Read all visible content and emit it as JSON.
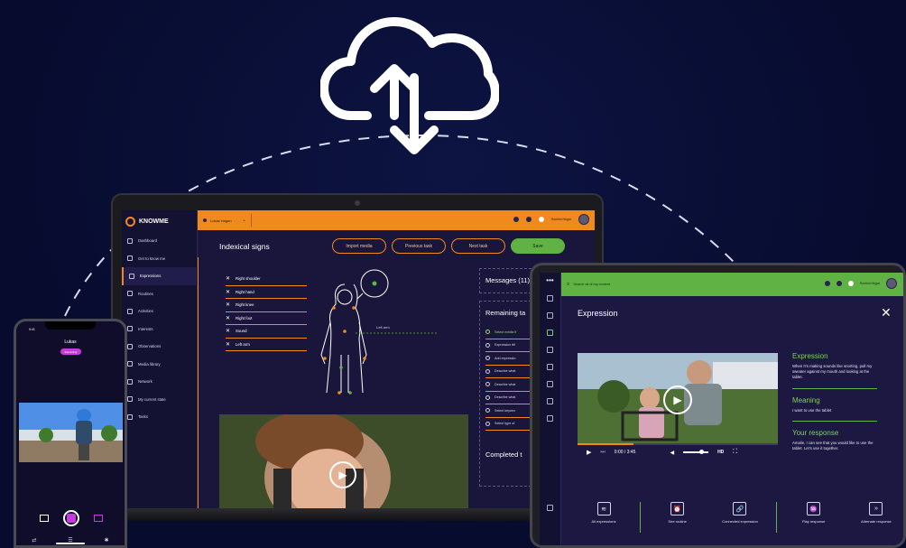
{
  "brand": {
    "name": "KNOWME",
    "accent": "#f08a1c",
    "green": "#5fb243",
    "background": "#070b2e"
  },
  "hero": {
    "icon": "cloud-upload-download-icon"
  },
  "laptop": {
    "user": "Lukas Hagen",
    "top_user": "Roshini Hegar",
    "title": "Indexical signs",
    "buttons": {
      "import": "Import media",
      "previous": "Previous task",
      "next": "Next task",
      "save": "Save"
    },
    "nav": [
      {
        "label": "Dashboard",
        "active": false
      },
      {
        "label": "Get to know me",
        "active": false
      },
      {
        "label": "Expressions",
        "active": true
      },
      {
        "label": "Routines",
        "active": false
      },
      {
        "label": "Activities",
        "active": false
      },
      {
        "label": "Interests",
        "active": false
      },
      {
        "label": "Observations",
        "active": false
      },
      {
        "label": "Media library",
        "active": false
      },
      {
        "label": "Network",
        "active": false
      },
      {
        "label": "My current state",
        "active": false
      },
      {
        "label": "Tasks",
        "active": false
      }
    ],
    "signs": [
      "Right shoulder",
      "Right hand",
      "Right knee",
      "Right foot",
      "Sound",
      "Left arm"
    ],
    "body_label": "Left arm",
    "messages": "Messages (11)",
    "remaining": "Remaining ta",
    "tasks": [
      {
        "label": "Select media fi",
        "done": true
      },
      {
        "label": "Expression titl",
        "done": false
      },
      {
        "label": "Add expressio",
        "done": false
      },
      {
        "label": "Describe what",
        "done": false
      },
      {
        "label": "Describe what",
        "done": false
      },
      {
        "label": "Describe what",
        "done": false
      },
      {
        "label": "Select keywor",
        "done": false
      },
      {
        "label": "Select type of",
        "done": false
      }
    ],
    "completed": "Completed t"
  },
  "phone": {
    "time": "9:41",
    "name": "Lukas",
    "badge": "Recording"
  },
  "tablet": {
    "search": "Search all of my content",
    "top_user": "Roshini Hegar",
    "title": "Expression",
    "video_time": "0:00 / 3:45",
    "quality": "HD",
    "sections": [
      {
        "heading": "Expression",
        "text": "When I'm making sounds like snorting, pull my sweater against my mouth and looking at the tablet."
      },
      {
        "heading": "Meaning",
        "text": "I want to use the tablet"
      },
      {
        "heading": "Your response",
        "text": "Amalie, I can see that you would like to use the tablet. Let's use it together."
      }
    ],
    "actions": [
      "All expressions",
      "See routine",
      "Connected expression",
      "Play response",
      "Alternate response"
    ]
  }
}
